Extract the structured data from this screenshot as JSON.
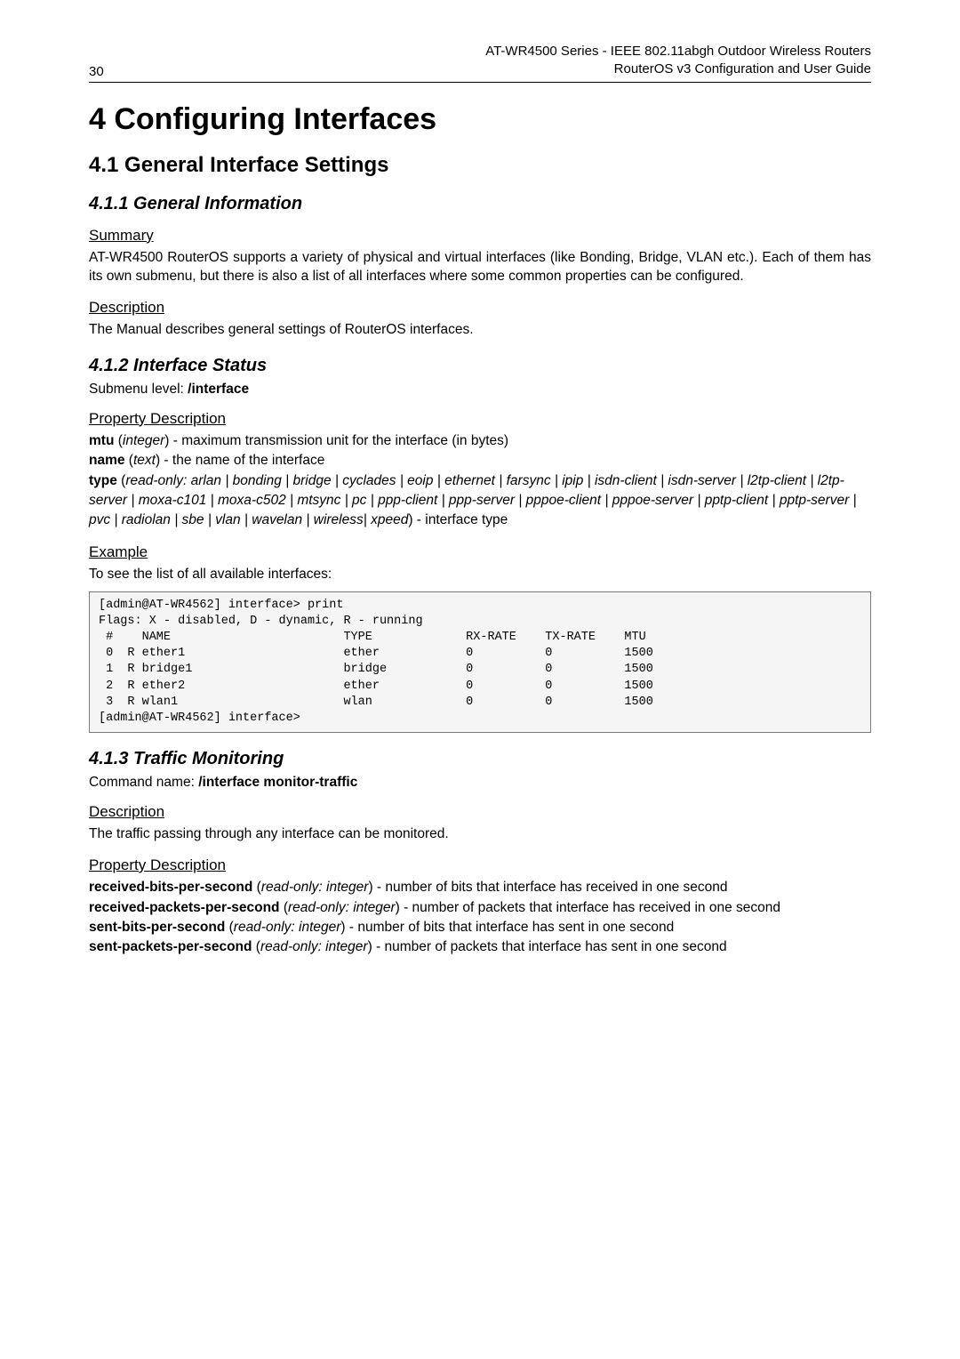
{
  "header": {
    "page_number": "30",
    "line1": "AT-WR4500 Series - IEEE 802.11abgh Outdoor Wireless Routers",
    "line2": "RouterOS v3 Configuration and User Guide"
  },
  "h1": "4 Configuring Interfaces",
  "h2_41": "4.1 General Interface Settings",
  "sec411": {
    "title": "4.1.1 General Information",
    "summary_h": "Summary",
    "summary_p": "AT-WR4500 RouterOS supports a variety of physical and virtual interfaces (like Bonding, Bridge, VLAN etc.). Each of them has its own submenu, but there is also a list of all interfaces where some common properties can be configured.",
    "desc_h": "Description",
    "desc_p": "The Manual describes general settings of RouterOS interfaces."
  },
  "sec412": {
    "title": "4.1.2 Interface Status",
    "submenu_label": "Submenu level: ",
    "submenu_val": "/interface",
    "prop_h": "Property Description",
    "prop": {
      "mtu_k": "mtu",
      "mtu_t": " (integer) - maximum transmission unit for the interface (in bytes)",
      "name_k": "name",
      "name_t": " (text) - the name of the interface",
      "type_k": "type",
      "type_t_pre": " (",
      "type_ital": "read-only: arlan | bonding | bridge | cyclades | eoip | ethernet | farsync | ipip | isdn-client | isdn-server | l2tp-client | l2tp-server | moxa-c101 | moxa-c502 | mtsync | pc | ppp-client | ppp-server | pppoe-client | pppoe-server | pptp-client | pptp-server | pvc | radiolan | sbe | vlan | wavelan | wireless| xpeed",
      "type_t_post": ") - interface type"
    },
    "example_h": "Example",
    "example_p": "To see the list of all available interfaces:",
    "code": "[admin@AT-WR4562] interface> print\nFlags: X - disabled, D - dynamic, R - running\n #    NAME                        TYPE             RX-RATE    TX-RATE    MTU\n 0  R ether1                      ether            0          0          1500\n 1  R bridge1                     bridge           0          0          1500\n 2  R ether2                      ether            0          0          1500\n 3  R wlan1                       wlan             0          0          1500\n[admin@AT-WR4562] interface>"
  },
  "sec413": {
    "title": "4.1.3 Traffic Monitoring",
    "cmd_label": "Command name: ",
    "cmd_val": "/interface monitor-traffic",
    "desc_h": "Description",
    "desc_p": "The traffic passing through any interface can be monitored.",
    "prop_h": "Property Description",
    "prop": {
      "rbps_k": "received-bits-per-second",
      "rbps_t": " (read-only: integer) - number of bits that interface has received in one second",
      "rpps_k": "received-packets-per-second",
      "rpps_t": " (read-only: integer) - number of packets that interface has received in one second",
      "sbps_k": "sent-bits-per-second",
      "sbps_t": " (read-only: integer) - number of bits that interface has sent in one second",
      "spps_k": "sent-packets-per-second",
      "spps_t": " (read-only: integer) - number of packets that interface has sent in one second"
    }
  }
}
